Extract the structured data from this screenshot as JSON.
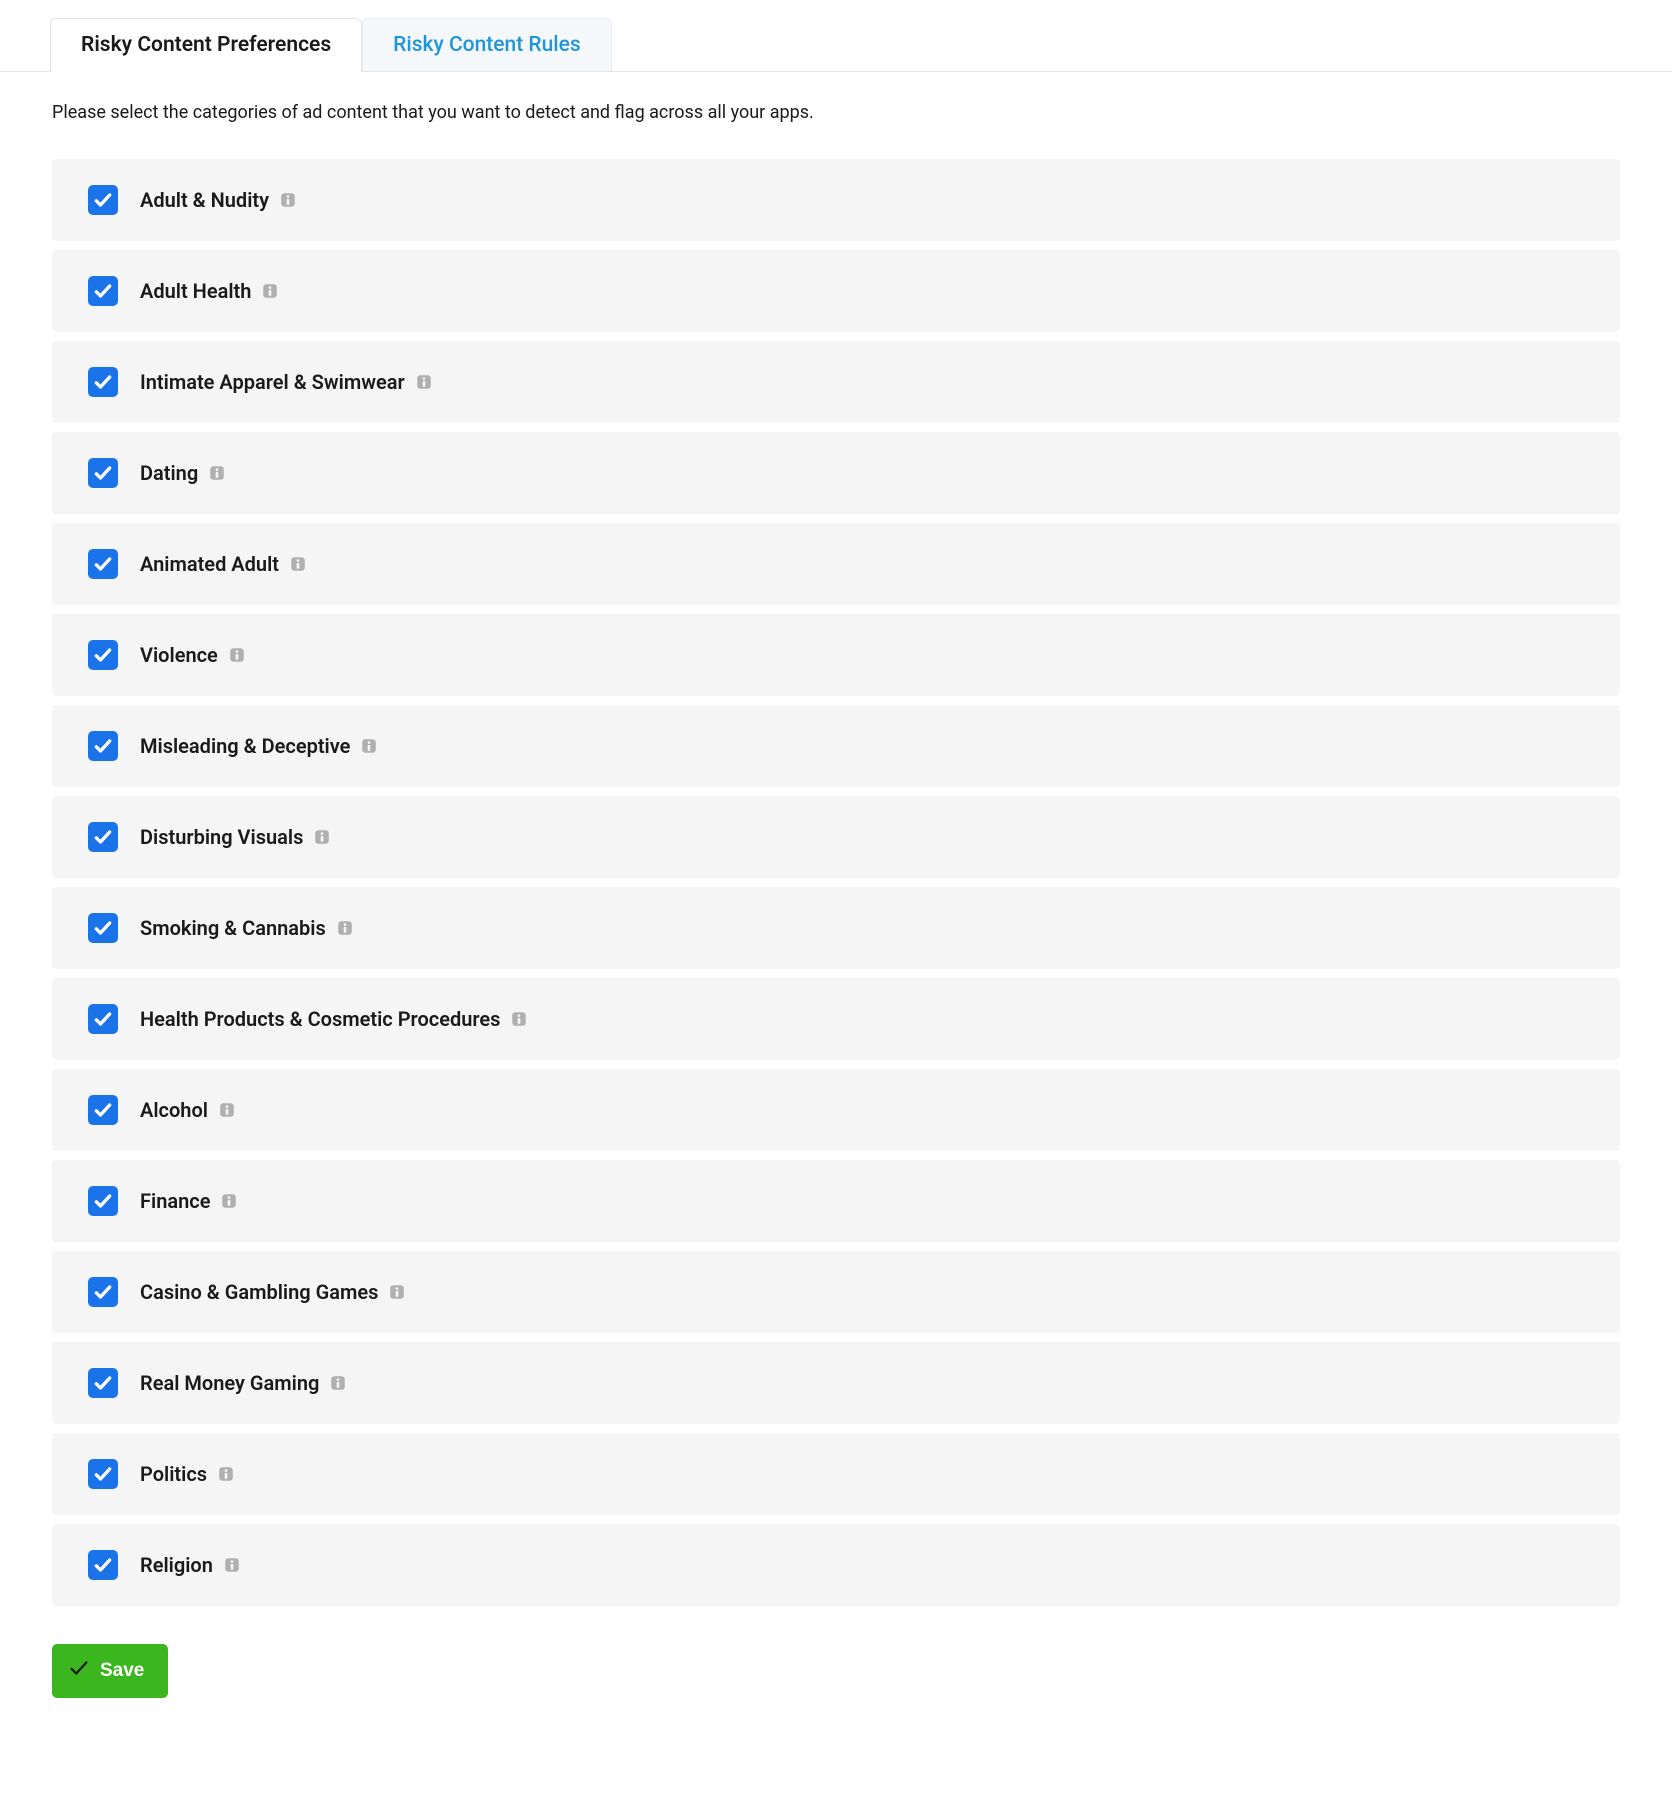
{
  "tabs": {
    "preferences": "Risky Content Preferences",
    "rules": "Risky Content Rules",
    "activeTab": "preferences"
  },
  "instruction": "Please select the categories of ad content that you want to detect and flag across all your apps.",
  "categories": [
    {
      "label": "Adult & Nudity",
      "checked": true
    },
    {
      "label": "Adult Health",
      "checked": true
    },
    {
      "label": "Intimate Apparel & Swimwear",
      "checked": true
    },
    {
      "label": "Dating",
      "checked": true
    },
    {
      "label": "Animated Adult",
      "checked": true
    },
    {
      "label": "Violence",
      "checked": true
    },
    {
      "label": "Misleading & Deceptive",
      "checked": true
    },
    {
      "label": "Disturbing Visuals",
      "checked": true
    },
    {
      "label": "Smoking & Cannabis",
      "checked": true
    },
    {
      "label": "Health Products & Cosmetic Procedures",
      "checked": true
    },
    {
      "label": "Alcohol",
      "checked": true
    },
    {
      "label": "Finance",
      "checked": true
    },
    {
      "label": "Casino & Gambling Games",
      "checked": true
    },
    {
      "label": "Real Money Gaming",
      "checked": true
    },
    {
      "label": "Politics",
      "checked": true
    },
    {
      "label": "Religion",
      "checked": true
    }
  ],
  "saveButton": {
    "label": "Save"
  },
  "colors": {
    "checkboxActive": "#1a73e8",
    "saveGreen": "#3bb61f",
    "linkBlue": "#2196d6",
    "rowBg": "#f5f5f5"
  }
}
